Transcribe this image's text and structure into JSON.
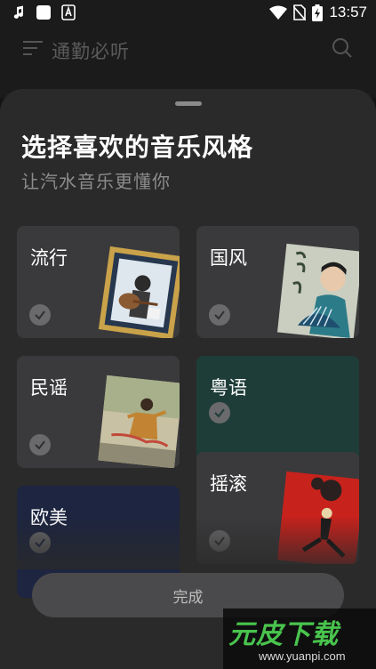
{
  "status_bar": {
    "time": "13:57"
  },
  "header": {
    "title": "通勤必听"
  },
  "sheet": {
    "title": "选择喜欢的音乐风格",
    "subtitle": "让汽水音乐更懂你"
  },
  "genres": [
    {
      "label": "流行"
    },
    {
      "label": "国风"
    },
    {
      "label": "民谣"
    },
    {
      "label": "粤语"
    },
    {
      "label": "摇滚"
    },
    {
      "label": "欧美"
    }
  ],
  "done_label": "完成",
  "watermark": {
    "logo": "元皮下载",
    "url": "www.yuanpi.com"
  },
  "colors": {
    "sheet_bg": "#2a2a2a",
    "card_bg": "#3a3a3c",
    "cantonese_bg": "#1e3d38",
    "euro_bg": "#1d2540",
    "watermark_green": "#49c44e"
  }
}
